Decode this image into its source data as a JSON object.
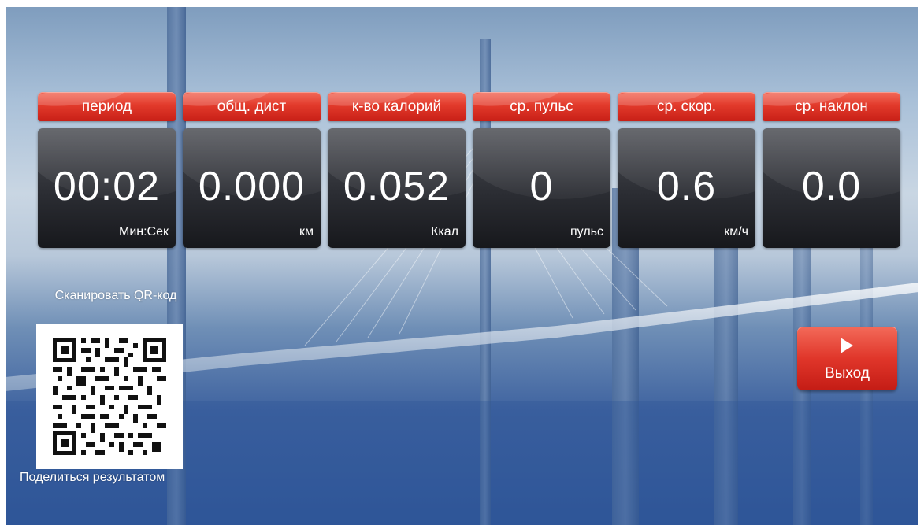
{
  "stats": [
    {
      "label": "период",
      "value": "00:02",
      "unit": "Мин:Сек"
    },
    {
      "label": "общ. дист",
      "value": "0.000",
      "unit": "км"
    },
    {
      "label": "к-во калорий",
      "value": "0.052",
      "unit": "Ккал"
    },
    {
      "label": "ср. пульс",
      "value": "0",
      "unit": "пульс"
    },
    {
      "label": "ср. скор.",
      "value": "0.6",
      "unit": "км/ч"
    },
    {
      "label": "ср. наклон",
      "value": "0.0",
      "unit": ""
    }
  ],
  "qr": {
    "title": "Сканировать QR-код",
    "icon": "qr-code-icon",
    "share_label": "Поделиться результатом"
  },
  "exit": {
    "label": "Выход",
    "icon": "play-icon"
  },
  "colors": {
    "header_red": "#e23a2b",
    "panel_dark": "#2b2d33",
    "text": "#ffffff"
  }
}
